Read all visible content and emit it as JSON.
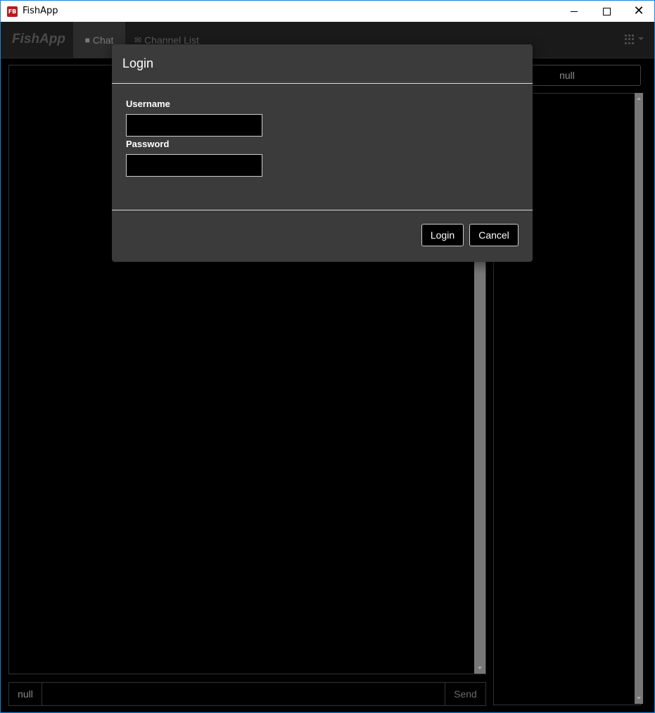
{
  "window": {
    "title": "FishApp",
    "icon_label": "FB"
  },
  "navbar": {
    "brand": "FishApp",
    "tabs": [
      {
        "label": "Chat",
        "icon": "chat-icon",
        "active": true
      },
      {
        "label": "Channel List",
        "icon": "envelope-icon",
        "active": false
      }
    ],
    "menu_icon": "grid-icon"
  },
  "chat": {
    "input_bar": {
      "name": "null",
      "message_value": "",
      "send_label": "Send"
    }
  },
  "sidebar": {
    "channel_button": "null"
  },
  "modal": {
    "title": "Login",
    "username_label": "Username",
    "username_value": "",
    "password_label": "Password",
    "password_value": "",
    "login_button": "Login",
    "cancel_button": "Cancel"
  },
  "colors": {
    "modal_bg": "#3b3b3b",
    "app_bg": "#000000",
    "brand_icon": "#b71c1c"
  }
}
